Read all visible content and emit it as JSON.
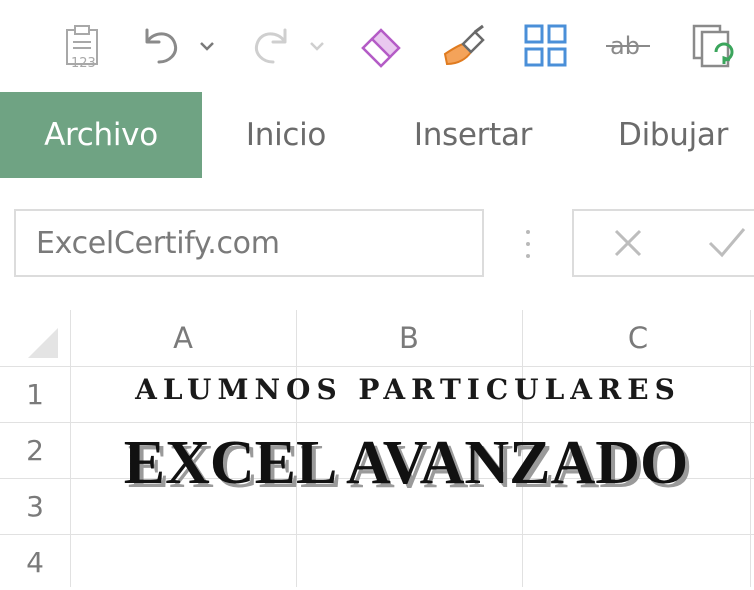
{
  "quick_access_toolbar": {
    "icons": [
      "paste-values-icon",
      "undo-icon",
      "undo-dropdown-icon",
      "redo-icon",
      "redo-dropdown-icon",
      "clear-formats-icon",
      "format-painter-icon",
      "grid-layout-icon",
      "strikethrough-icon",
      "copy-refresh-icon"
    ],
    "paste_values_label": "123",
    "strikethrough_label": "ab"
  },
  "ribbon": {
    "tabs": [
      {
        "label": "Archivo",
        "active": true
      },
      {
        "label": "Inicio",
        "active": false
      },
      {
        "label": "Insertar",
        "active": false
      },
      {
        "label": "Dibujar",
        "active": false
      }
    ],
    "active_color": "#6fa383"
  },
  "formula_bar": {
    "name_box_value": "ExcelCertify.com",
    "cancel_icon": "close-icon",
    "enter_icon": "checkmark-icon"
  },
  "sheet": {
    "columns": [
      "A",
      "B",
      "C"
    ],
    "rows": [
      "1",
      "2",
      "3",
      "4"
    ]
  },
  "overlay": {
    "line1": "ALUMNOS PARTICULARES",
    "line2": "EXCEL AVANZADO"
  }
}
